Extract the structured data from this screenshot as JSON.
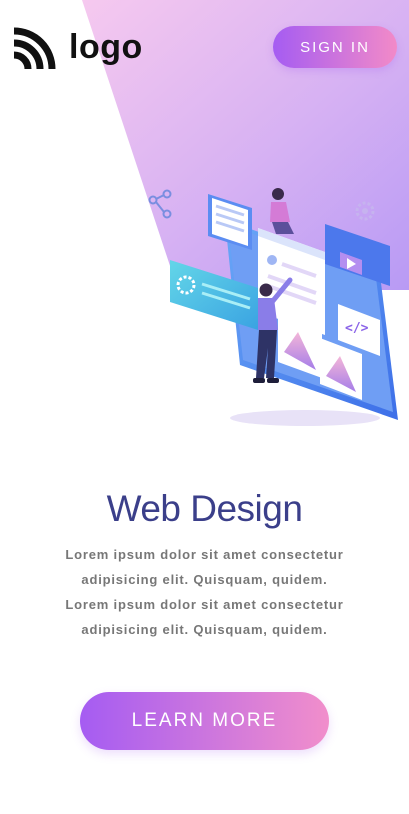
{
  "header": {
    "logo_text": "logo",
    "signin_label": "SIGN IN"
  },
  "hero": {
    "title": "Web Design",
    "description": "Lorem ipsum dolor sit amet consectetur adipisicing elit. Quisquam, quidem. Lorem ipsum dolor sit amet consectetur adipisicing elit. Quisquam, quidem.",
    "cta_label": "LEARN MORE"
  },
  "colors": {
    "accent_start": "#a55cf2",
    "accent_end": "#f28ac8",
    "title": "#3b3f8a",
    "body_text": "#777777"
  },
  "icons": {
    "logo": "wifi-signal-icon",
    "illustration": "web-design-illustration",
    "share": "share-icon",
    "gear": "gear-icon"
  }
}
